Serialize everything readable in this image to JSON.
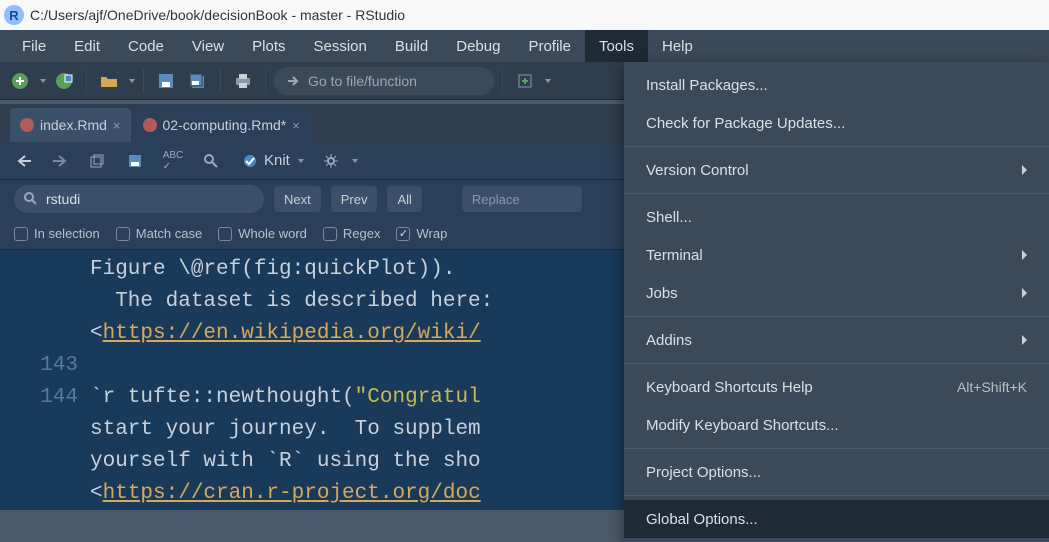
{
  "window": {
    "title": "C:/Users/ajf/OneDrive/book/decisionBook - master - RStudio"
  },
  "menubar": {
    "items": [
      "File",
      "Edit",
      "Code",
      "View",
      "Plots",
      "Session",
      "Build",
      "Debug",
      "Profile",
      "Tools",
      "Help"
    ],
    "active": "Tools"
  },
  "toolbar": {
    "goto_placeholder": "Go to file/function"
  },
  "tabs": [
    {
      "label": "index.Rmd",
      "dirty": false,
      "active": false
    },
    {
      "label": "02-computing.Rmd*",
      "dirty": true,
      "active": true
    }
  ],
  "editor_toolbar": {
    "knit_label": "Knit"
  },
  "find": {
    "query": "rstudi",
    "next": "Next",
    "prev": "Prev",
    "all": "All",
    "replace": "Replace",
    "opts": {
      "in_selection": "In selection",
      "match_case": "Match case",
      "whole_word": "Whole word",
      "regex": "Regex",
      "wrap": "Wrap",
      "wrap_checked": true
    }
  },
  "code": {
    "line1": "Figure \\@ref(fig:quickPlot)).",
    "line2": "  The dataset is described here:",
    "url1": "https://en.wikipedia.org/wiki/",
    "line_num_143": "143",
    "line_num_144": "144",
    "line4a": "`r tufte::newthought(",
    "str4": "\"Congratul",
    "line5": "start your journey.  To supplem",
    "line6": "yourself with `R` using the sho",
    "url2": "https://cran.r-project.org/doc"
  },
  "tools_menu": {
    "install": "Install Packages...",
    "check_updates": "Check for Package Updates...",
    "version_control": "Version Control",
    "shell": "Shell...",
    "terminal": "Terminal",
    "jobs": "Jobs",
    "addins": "Addins",
    "kb_help": "Keyboard Shortcuts Help",
    "kb_help_shortcut": "Alt+Shift+K",
    "modify_kb": "Modify Keyboard Shortcuts...",
    "project_opts": "Project Options...",
    "global_opts": "Global Options..."
  }
}
